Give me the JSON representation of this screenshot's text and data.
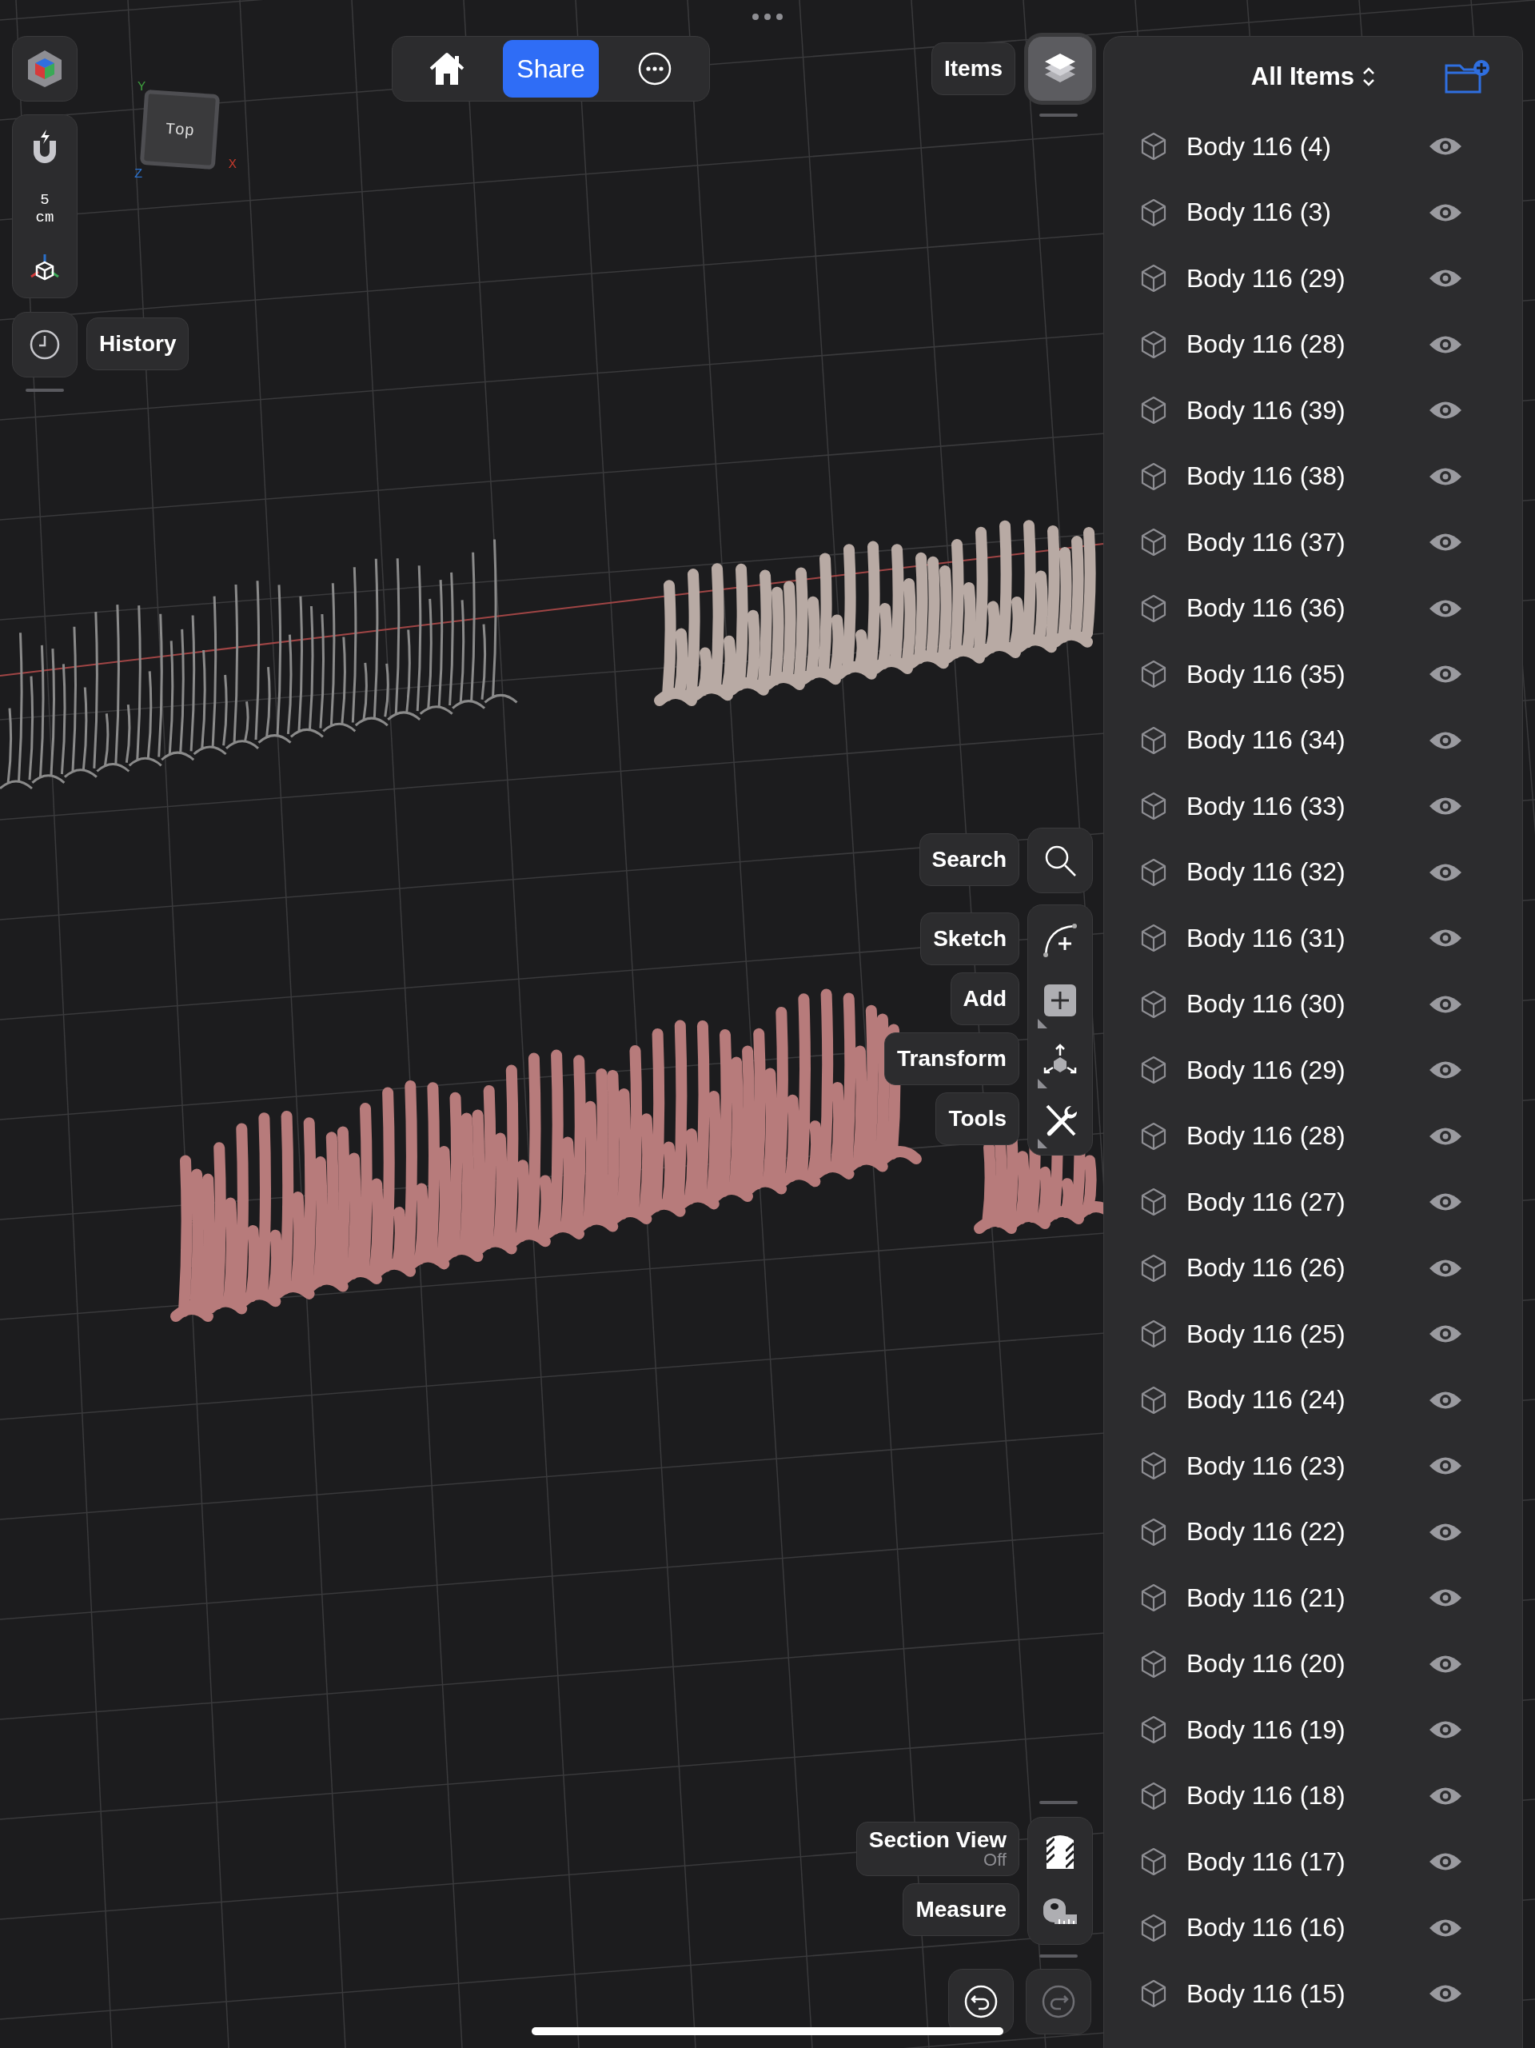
{
  "view_cube": {
    "face": "Top",
    "axes": [
      {
        "label": "Y",
        "color": "#3c9a3c"
      },
      {
        "label": "Z",
        "color": "#2a6fc9"
      },
      {
        "label": "X",
        "color": "#c0392b"
      }
    ]
  },
  "snap": {
    "value": "5",
    "unit": "cm"
  },
  "history": {
    "label": "History"
  },
  "top_toolbar": {
    "share": "Share"
  },
  "items_toggle": {
    "label": "Items",
    "selected": true
  },
  "items_panel": {
    "title": "All Items",
    "items": [
      {
        "name": "Body 116 (4)",
        "visible": true
      },
      {
        "name": "Body 116 (3)",
        "visible": true
      },
      {
        "name": "Body 116 (29)",
        "visible": true
      },
      {
        "name": "Body 116 (28)",
        "visible": true
      },
      {
        "name": "Body 116 (39)",
        "visible": true
      },
      {
        "name": "Body 116 (38)",
        "visible": true
      },
      {
        "name": "Body 116 (37)",
        "visible": true
      },
      {
        "name": "Body 116 (36)",
        "visible": true
      },
      {
        "name": "Body 116 (35)",
        "visible": true
      },
      {
        "name": "Body 116 (34)",
        "visible": true
      },
      {
        "name": "Body 116 (33)",
        "visible": true
      },
      {
        "name": "Body 116 (32)",
        "visible": true
      },
      {
        "name": "Body 116 (31)",
        "visible": true
      },
      {
        "name": "Body 116 (30)",
        "visible": true
      },
      {
        "name": "Body 116 (29)",
        "visible": true
      },
      {
        "name": "Body 116 (28)",
        "visible": true
      },
      {
        "name": "Body 116 (27)",
        "visible": true
      },
      {
        "name": "Body 116 (26)",
        "visible": true
      },
      {
        "name": "Body 116 (25)",
        "visible": true
      },
      {
        "name": "Body 116 (24)",
        "visible": true
      },
      {
        "name": "Body 116 (23)",
        "visible": true
      },
      {
        "name": "Body 116 (22)",
        "visible": true
      },
      {
        "name": "Body 116 (21)",
        "visible": true
      },
      {
        "name": "Body 116 (20)",
        "visible": true
      },
      {
        "name": "Body 116 (19)",
        "visible": true
      },
      {
        "name": "Body 116 (18)",
        "visible": true
      },
      {
        "name": "Body 116 (17)",
        "visible": true
      },
      {
        "name": "Body 116 (16)",
        "visible": true
      },
      {
        "name": "Body 116 (15)",
        "visible": true
      }
    ]
  },
  "tools": [
    {
      "label": "Search",
      "kind": "search"
    },
    {
      "label": "Sketch",
      "kind": "sketch"
    },
    {
      "label": "Add",
      "kind": "add"
    },
    {
      "label": "Transform",
      "kind": "transform"
    },
    {
      "label": "Tools",
      "kind": "tools"
    }
  ],
  "section_view": {
    "label": "Section View",
    "status": "Off"
  },
  "measure": {
    "label": "Measure"
  },
  "history_controls": {
    "undo_disabled": false,
    "redo_disabled": true
  }
}
